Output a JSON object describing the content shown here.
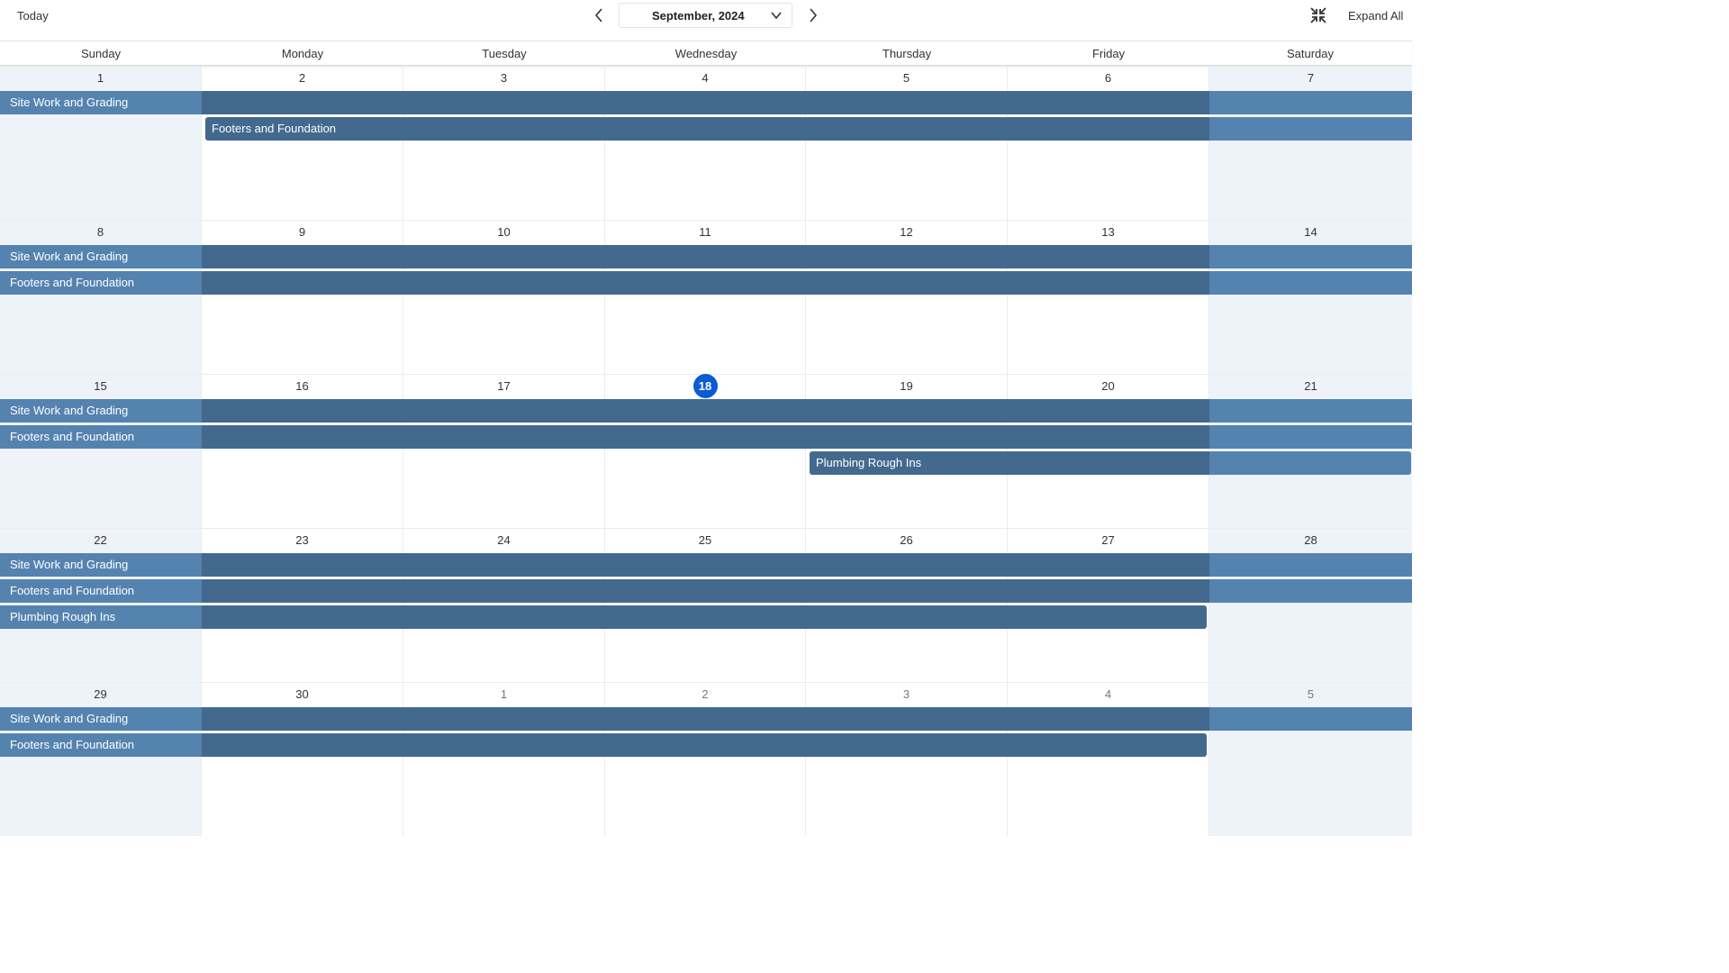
{
  "toolbar": {
    "today_label": "Today",
    "month_label": "September, 2024",
    "expand_all_label": "Expand All",
    "prev_icon": "chevron-left-icon",
    "next_icon": "chevron-right-icon",
    "collapse_icon": "collapse-icon"
  },
  "weekdays": [
    "Sunday",
    "Monday",
    "Tuesday",
    "Wednesday",
    "Thursday",
    "Friday",
    "Saturday"
  ],
  "weeks": [
    {
      "days": [
        "1",
        "2",
        "3",
        "4",
        "5",
        "6",
        "7"
      ]
    },
    {
      "days": [
        "8",
        "9",
        "10",
        "11",
        "12",
        "13",
        "14"
      ]
    },
    {
      "days": [
        "15",
        "16",
        "17",
        "18",
        "19",
        "20",
        "21"
      ]
    },
    {
      "days": [
        "22",
        "23",
        "24",
        "25",
        "26",
        "27",
        "28"
      ]
    },
    {
      "days": [
        "29",
        "30",
        "1",
        "2",
        "3",
        "4",
        "5"
      ]
    }
  ],
  "today": "18",
  "events": {
    "site_work": "Site Work and Grading",
    "footers": "Footers and Foundation",
    "plumbing": "Plumbing Rough Ins"
  },
  "colors": {
    "bar_light": "#5583b0",
    "bar_dark": "#43698f",
    "today": "#0b5bd3",
    "weekend_bg": "#eef2f9"
  }
}
